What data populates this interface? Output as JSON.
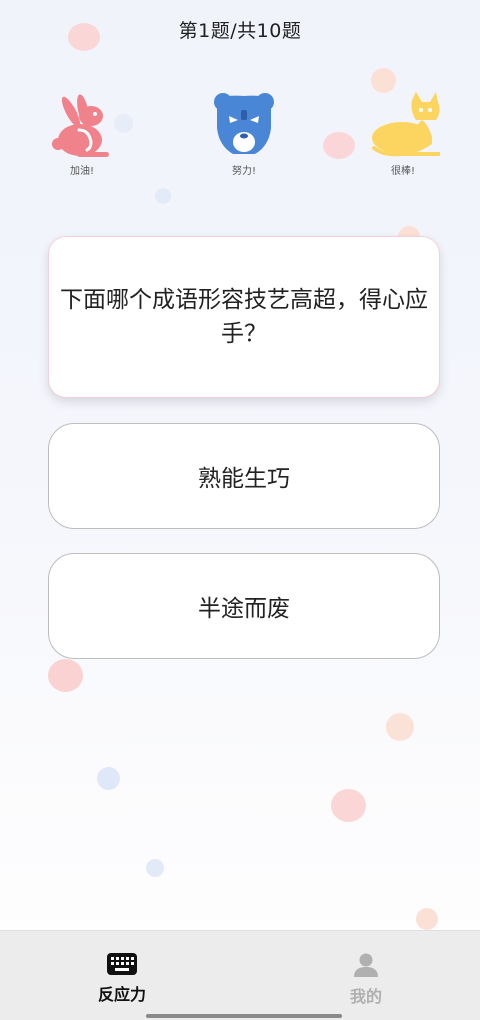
{
  "header": {
    "title": "第1题/共10题"
  },
  "mascots": [
    {
      "icon": "rabbit-icon",
      "label": "加油!",
      "color": "#f0828c"
    },
    {
      "icon": "bear-icon",
      "label": "努力!",
      "color": "#4a86d6"
    },
    {
      "icon": "cat-icon",
      "label": "很棒!",
      "color": "#fbd560"
    }
  ],
  "question": {
    "text": "下面哪个成语形容技艺高超，得心应手？"
  },
  "options": [
    {
      "label": "熟能生巧"
    },
    {
      "label": "半途而废"
    }
  ],
  "bottom_nav": {
    "tabs": [
      {
        "label": "反应力",
        "icon": "keyboard-icon",
        "active": true,
        "color": "#111111"
      },
      {
        "label": "我的",
        "icon": "person-icon",
        "active": false,
        "color": "#b0b0b0"
      }
    ]
  }
}
